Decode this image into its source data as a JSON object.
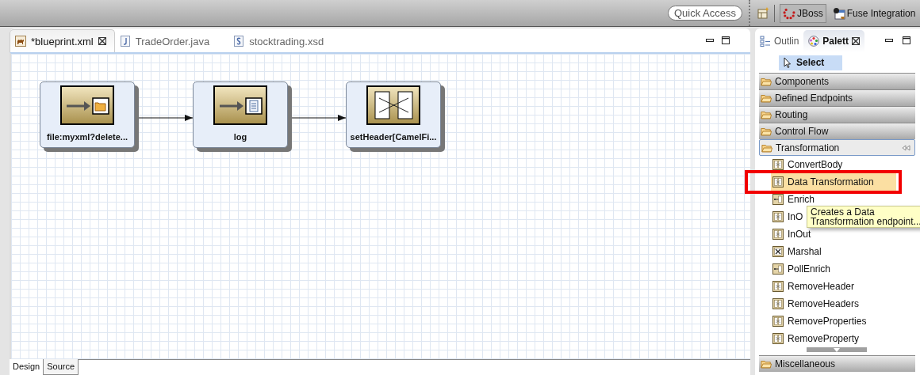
{
  "toolbar": {
    "quick_access": {
      "placeholder": "Quick Access"
    },
    "perspectives": [
      {
        "label": "JBoss",
        "kind": "jboss",
        "selected": true
      },
      {
        "label": "Fuse Integration",
        "kind": "fuse",
        "selected": false
      }
    ]
  },
  "editor": {
    "tabs": [
      {
        "label": "*blueprint.xml",
        "kind": "camel",
        "selected": true
      },
      {
        "label": "TradeOrder.java",
        "kind": "java",
        "selected": false
      },
      {
        "label": "stocktrading.xsd",
        "kind": "xsd",
        "selected": false
      }
    ],
    "nodes": [
      {
        "label": "file:myxml?delete...",
        "kind": "file"
      },
      {
        "label": "log",
        "kind": "log"
      },
      {
        "label": "setHeader[CamelFi...",
        "kind": "set-header"
      }
    ],
    "bottom_tabs": [
      {
        "label": "Design",
        "selected": true
      },
      {
        "label": "Source",
        "selected": false
      }
    ]
  },
  "palette": {
    "view_tabs": [
      {
        "label": "Outlin",
        "selected": false
      },
      {
        "label": "Palett",
        "selected": true
      }
    ],
    "select_tool": "Select",
    "drawers": [
      {
        "label": "Components",
        "expanded": false
      },
      {
        "label": "Defined Endpoints",
        "expanded": false
      },
      {
        "label": "Routing",
        "expanded": false
      },
      {
        "label": "Control Flow",
        "expanded": false
      },
      {
        "label": "Transformation",
        "expanded": true,
        "items": [
          {
            "label": "ConvertBody",
            "kind": "split",
            "selected": false
          },
          {
            "label": "Data Transformation",
            "kind": "split",
            "selected": true
          },
          {
            "label": "Enrich",
            "kind": "enrich",
            "selected": false
          },
          {
            "label": "InO",
            "kind": "split",
            "selected": false
          },
          {
            "label": "InOut",
            "kind": "split",
            "selected": false
          },
          {
            "label": "Marshal",
            "kind": "cross",
            "selected": false
          },
          {
            "label": "PollEnrich",
            "kind": "enrich",
            "selected": false
          },
          {
            "label": "RemoveHeader",
            "kind": "split",
            "selected": false
          },
          {
            "label": "RemoveHeaders",
            "kind": "split",
            "selected": false
          },
          {
            "label": "RemoveProperties",
            "kind": "split",
            "selected": false
          },
          {
            "label": "RemoveProperty",
            "kind": "split",
            "selected": false
          }
        ]
      },
      {
        "label": "Miscellaneous",
        "expanded": false
      }
    ],
    "tooltip": [
      "Creates a Data",
      "Transformation endpoint..."
    ]
  }
}
